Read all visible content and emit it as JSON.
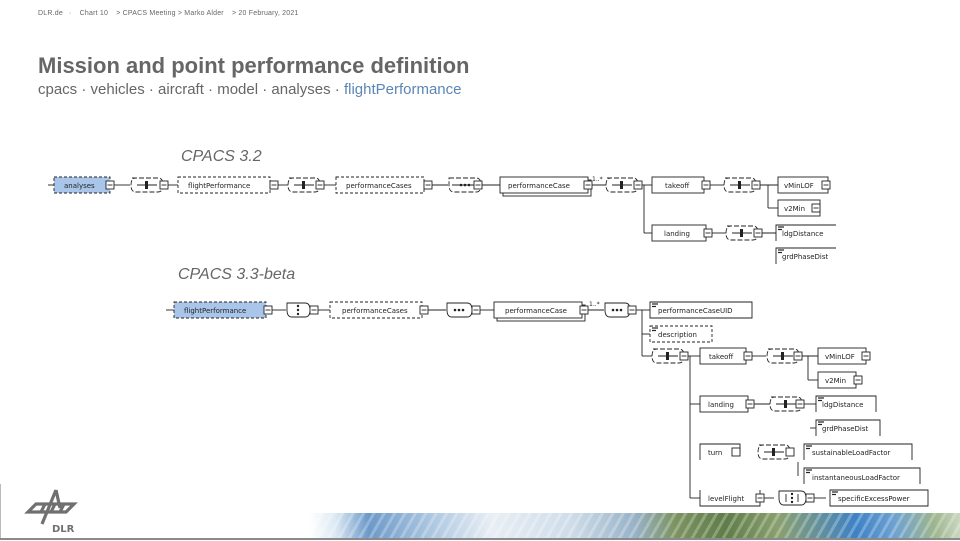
{
  "header": {
    "site": "DLR.de",
    "chart": "Chart 10",
    "event": "> CPACS Meeting > Marko Alder",
    "date": "> 20 February, 2021"
  },
  "title": "Mission and point performance definition",
  "path": {
    "prefix": "cpacs · vehicles · aircraft  · model · analyses · ",
    "highlight": "flightPerformance"
  },
  "colors": {
    "text": "#666666",
    "highlight": "#5b86b5",
    "selected_node_fill": "#a9c6ea"
  },
  "diagrams": {
    "v32": {
      "label": "CPACS 3.2",
      "nodes": {
        "analyses": "analyses",
        "flightPerformance": "flightPerformance",
        "performanceCases": "performanceCases",
        "performanceCase": "performanceCase",
        "takeoff": "takeoff",
        "landing": "landing",
        "vMinLOF": "vMinLOF",
        "v2Min": "v2Min",
        "ldgDistance": "ldgDistance",
        "grdPhaseDist": "grdPhaseDist"
      },
      "multiplicity": "1..*"
    },
    "v33": {
      "label": "CPACS 3.3-beta",
      "nodes": {
        "flightPerformance": "flightPerformance",
        "performanceCases": "performanceCases",
        "performanceCase": "performanceCase",
        "performanceCaseUID": "performanceCaseUID",
        "description": "description",
        "takeoff": "takeoff",
        "vMinLOF": "vMinLOF",
        "v2Min": "v2Min",
        "landing": "landing",
        "ldgDistance": "ldgDistance",
        "grdPhaseDist": "grdPhaseDist",
        "turn": "turn",
        "sustainableLoadFactor": "sustainableLoadFactor",
        "instantaneousLoadFactor": "instantaneousLoadFactor",
        "levelFlight": "levelFlight",
        "specificExcessPower": "specificExcessPower"
      },
      "multiplicity": "1..*"
    }
  },
  "logo": {
    "text": "DLR"
  }
}
